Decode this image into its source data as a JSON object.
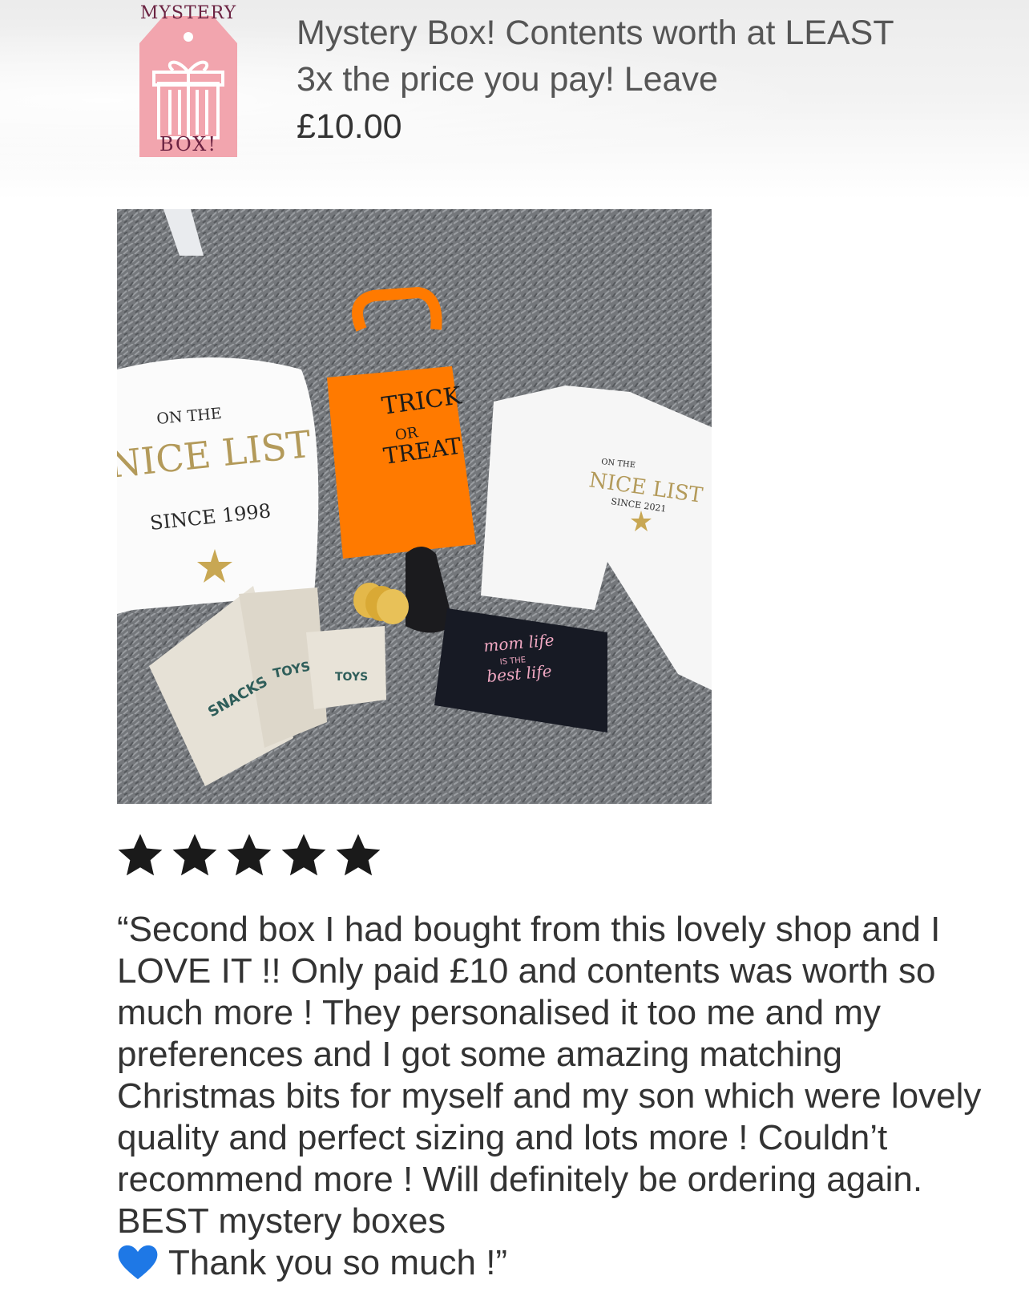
{
  "listing": {
    "thumbnail_brand_top": "MYSTERY",
    "thumbnail_brand_bottom": "BOX!",
    "title": "Mystery Box! Contents worth at LEAST 3x the price you pay! Leave",
    "price": "£10.00"
  },
  "photo": {
    "items": {
      "adult_top_line1": "ON THE",
      "adult_top_line2": "NICE LIST",
      "adult_top_line3": "SINCE 1998",
      "bag_text_line1": "TRICK",
      "bag_text_line2": "OR",
      "bag_text_line3": "TREAT",
      "kid_top_line1": "ON THE",
      "kid_top_line2": "NICE LIST",
      "kid_top_line3": "SINCE 2021",
      "pouch_1": "SNACKS",
      "pouch_2": "TOYS",
      "pouch_3": "TOYS",
      "black_pouch_line1": "mom life",
      "black_pouch_line2": "IS THE",
      "black_pouch_line3": "best life"
    }
  },
  "review": {
    "rating": 5,
    "rating_max": 5,
    "text": "“Second box I had bought from this lovely shop and I LOVE IT !! Only paid £10 and contents was worth so much more ! They personalised it too me and my preferences and I got some amazing matching Christmas bits for myself and my son which were lovely quality and perfect sizing and lots more ! Couldn’t recommend more ! Will definitely be ordering again. BEST mystery boxes",
    "text_end": "Thank you so much !”",
    "emoji": "blue-heart-icon"
  },
  "colors": {
    "star": "#1a1a1a",
    "heart": "#1e78e6",
    "thumbnail_tag": "#f2a5ae",
    "bag_orange": "#ff7a00"
  }
}
